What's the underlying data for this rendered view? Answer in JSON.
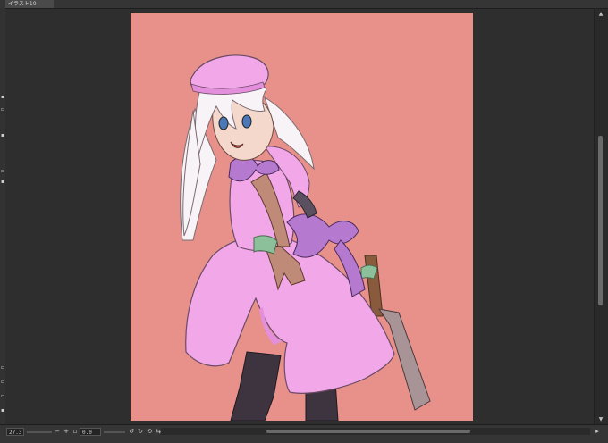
{
  "document_tab": {
    "title": "イラスト10"
  },
  "toolbar_left": {
    "icons": [
      "tool-icon-1",
      "tool-icon-2",
      "tool-icon-3",
      "tool-icon-4",
      "tool-icon-5"
    ]
  },
  "status_bar": {
    "zoom_value": "27.3",
    "angle_value": "0.0",
    "icons": [
      "zoom-out-icon",
      "zoom-in-icon",
      "fit-icon",
      "rotate-left-icon",
      "rotate-right-icon",
      "reset-icon",
      "flip-icon"
    ]
  },
  "canvas": {
    "background_color": "#e8918a",
    "description_colors": {
      "dress": "#f2a8e8",
      "ribbon": "#b57ad0",
      "hair": "#f7f3f6",
      "skin": "#c08a78",
      "stockings": "#3e3440",
      "blade": "#a89496"
    }
  }
}
